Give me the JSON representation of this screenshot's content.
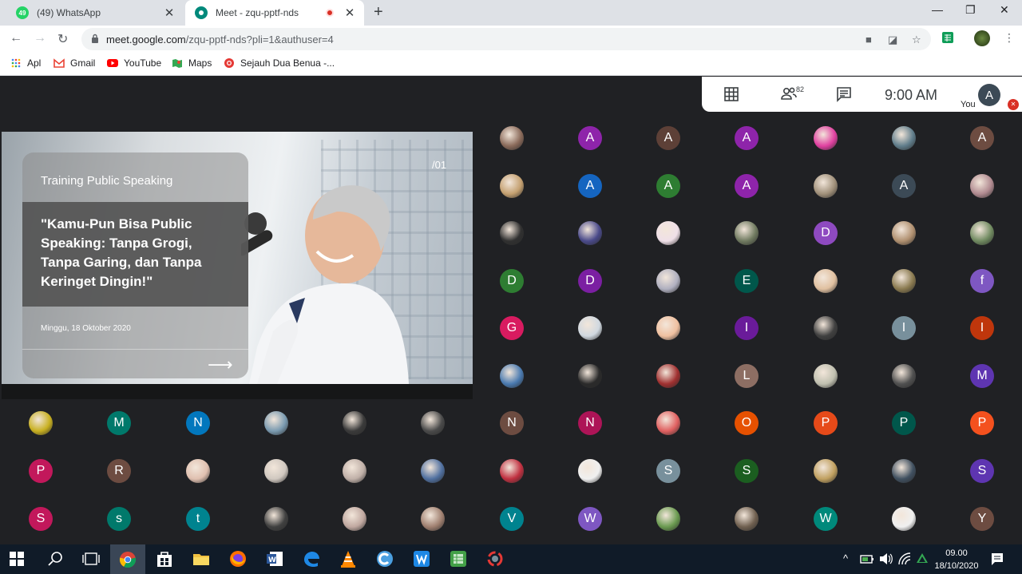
{
  "browser": {
    "tabs": [
      {
        "title": "(49) WhatsApp",
        "badge": "49",
        "active": false
      },
      {
        "title": "Meet - zqu-pptf-nds",
        "active": true
      }
    ],
    "url_domain": "meet.google.com",
    "url_path": "/zqu-pptf-nds?pli=1&authuser=4",
    "bookmarks": [
      "Apl",
      "Gmail",
      "YouTube",
      "Maps",
      "Sejauh Dua Benua -..."
    ]
  },
  "meet": {
    "participant_count": "82",
    "clock": "9:00  AM",
    "self_label": "You",
    "self_initial": "A",
    "slide": {
      "heading": "Training Public Speaking",
      "quote": "\"Kamu-Pun Bisa Public Speaking: Tanpa Grogi, Tanpa Garing, dan Tanpa Keringet Dingin!\"",
      "date": "Minggu, 18 Oktober 2020",
      "page": "/01"
    },
    "grid_right": [
      [
        "",
        "A",
        "A",
        "A",
        "",
        "",
        "A"
      ],
      [
        "",
        "A",
        "A",
        "A",
        "",
        "A",
        ""
      ],
      [
        "",
        "",
        "",
        "",
        "D",
        "",
        ""
      ],
      [
        "D",
        "D",
        "",
        "E",
        "",
        "",
        "f"
      ],
      [
        "G",
        "",
        "",
        "I",
        "",
        "I",
        "I"
      ],
      [
        "",
        "",
        "",
        "L",
        "",
        "",
        "M"
      ],
      [
        "N",
        "N",
        "",
        "O",
        "P",
        "P",
        "P"
      ],
      [
        "",
        "",
        "S",
        "S",
        "",
        "",
        "S"
      ],
      [
        "V",
        "W",
        "",
        "",
        "W",
        "",
        "Y"
      ]
    ],
    "grid_left": [
      [
        "",
        "M",
        "N",
        "",
        "",
        ""
      ],
      [
        "P",
        "R",
        "",
        "",
        "",
        ""
      ],
      [
        "S",
        "s",
        "t",
        "",
        "",
        ""
      ]
    ]
  },
  "colors": {
    "grid_right": [
      [
        "#8a6a5a",
        "#8e24aa",
        "#5d4037",
        "#8e24aa",
        "#e040a0",
        "#607d8b",
        "#6d4c41"
      ],
      [
        "#c4a070",
        "#1565c0",
        "#2e7d32",
        "#8e24aa",
        "#a0907a",
        "#3c4a56",
        "#b08a90"
      ],
      [
        "#303030",
        "#4a4a8a",
        "#f0e0e8",
        "#707a60",
        "#8e4ac0",
        "#b09070",
        "#708a60"
      ],
      [
        "#2e7d32",
        "#7b1fa2",
        "#b0b0c0",
        "#00574b",
        "#e0c0a0",
        "#8a7a50",
        "#7e57c2"
      ],
      [
        "#d81b60",
        "#d0d8e0",
        "#f0c0a0",
        "#6a1b9a",
        "#404040",
        "#78909c",
        "#bf360c"
      ],
      [
        "#4a7ab0",
        "#2a2a2a",
        "#a03030",
        "#8d6e63",
        "#c0c0b0",
        "#505050",
        "#5e35b1"
      ],
      [
        "#6d4c41",
        "#ad1457",
        "#e06060",
        "#e65100",
        "#e64a19",
        "#00574b",
        "#f4511e"
      ],
      [
        "#c03040",
        "#f0f0f0",
        "#78909c",
        "#1b5e20",
        "#c0a060",
        "#405060",
        "#5e35b1"
      ],
      [
        "#00838f",
        "#7e57c2",
        "#6a9a50",
        "#706050",
        "#00897b",
        "#f0f0f0",
        "#6d4c41"
      ]
    ],
    "grid_left": [
      [
        "#c8b020",
        "#00796b",
        "#0277bd",
        "#7a9ab0",
        "#3a3a3a",
        "#4a4a4a"
      ],
      [
        "#c2185b",
        "#6d4c41",
        "#e0c0b0",
        "#d0c8c0",
        "#c0b0a8",
        "#5070a0"
      ],
      [
        "#c2185b",
        "#00796b",
        "#00838f",
        "#404040",
        "#c0a8a0",
        "#a08070"
      ]
    ]
  },
  "taskbar": {
    "time": "09.00",
    "date": "18/10/2020"
  }
}
